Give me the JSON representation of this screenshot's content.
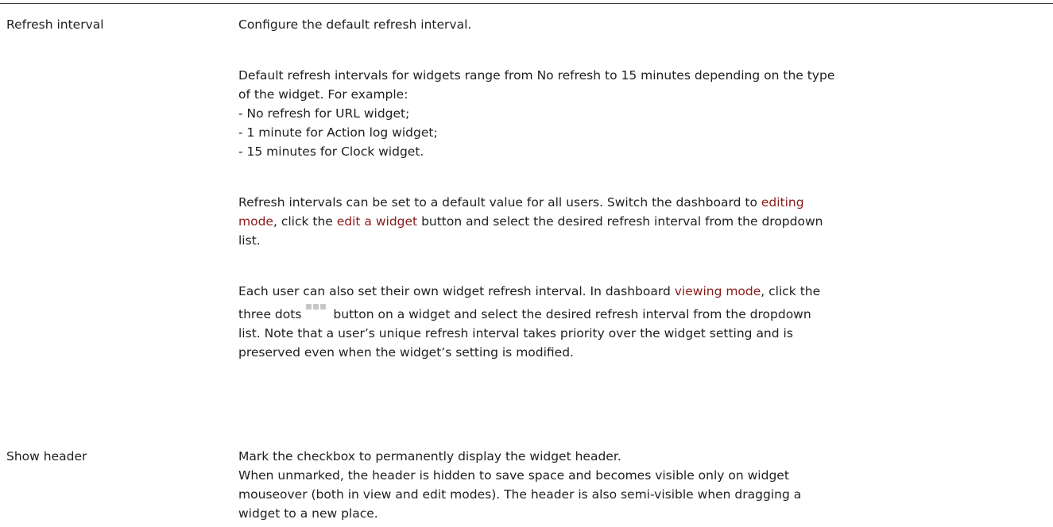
{
  "rows": [
    {
      "term": "Refresh interval",
      "intro": "Configure the default refresh interval.",
      "p2_line1": "Default refresh intervals for widgets range from No refresh to 15 minutes depending on the type",
      "p2_line2": "of the widget. For example:",
      "list": [
        "- No refresh for URL widget;",
        "- 1 minute for Action log widget;",
        "- 15 minutes for Clock widget."
      ],
      "p3_a": "Refresh intervals can be set to a default value for all users. Switch the dashboard to ",
      "p3_link1a": "editing",
      "p3_link1b": "mode",
      "p3_b": ", click the ",
      "p3_link2": "edit a widget",
      "p3_c": " button and select the desired refresh interval from the dropdown",
      "p3_d": "list.",
      "p4_a": "Each user can also set their own widget refresh interval. In dashboard ",
      "p4_link": "viewing mode",
      "p4_b": ", click the",
      "p4_c": "three dots",
      "p4_icon": "three-dots-icon",
      "p4_d": "button on a widget and select the desired refresh interval from the dropdown",
      "p4_e": "list. Note that a user’s unique refresh interval takes priority over the widget setting and is",
      "p4_f": "preserved even when the widget’s setting is modified."
    },
    {
      "term": "Show header",
      "line1": "Mark the checkbox to permanently display the widget header.",
      "line2": "When unmarked, the header is hidden to save space and becomes visible only on widget",
      "line3": "mouseover (both in view and edit modes). The header is also semi-visible when dragging a",
      "line4": "widget to a new place."
    }
  ],
  "colors": {
    "link": "#8b1a1a",
    "text": "#1f1f1f",
    "rule": "#3a3a3a",
    "icon": "#c7c7c7"
  }
}
